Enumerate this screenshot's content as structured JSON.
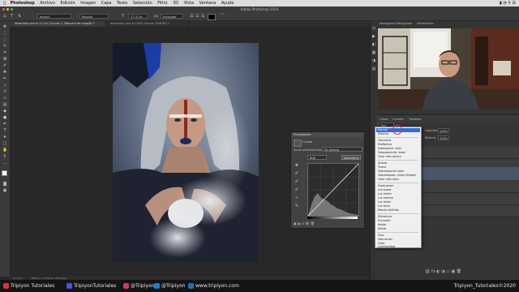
{
  "menu": {
    "app": "Photoshop",
    "items": [
      "Archivo",
      "Edición",
      "Imagen",
      "Capa",
      "Texto",
      "Selección",
      "Filtro",
      "3D",
      "Vista",
      "Ventana",
      "Ayuda"
    ]
  },
  "window": {
    "title": "Adobe Photoshop 2020"
  },
  "options": {
    "font": "Impact",
    "style": "Regular",
    "size": "37.37 pt",
    "aa": "Enfocado"
  },
  "tabs": [
    {
      "label": "desarrollo.psd al 11,1% (Curvas 2, Máscara de capa/8) *"
    },
    {
      "label": "desarrollo_psd al 100% (Fondo, RGB/8*) *"
    }
  ],
  "status": {
    "zoom": "11,11%",
    "info": "3840 px x 5760 px (300 ppp)"
  },
  "panels": {
    "navigator_tabs": [
      "Navegador",
      "Histograma",
      "Información"
    ],
    "layers_tabs": [
      "Capas",
      "Canales",
      "Trazados"
    ],
    "layers_kind": "Tipo",
    "layers_opacity_label": "Opacidad:",
    "layers_opacity_value": "100%",
    "layers_fill_label": "Relleno:",
    "layers_fill_value": "100%"
  },
  "properties": {
    "title": "Propiedades",
    "type": "Curvas",
    "preset_label": "Ajuste preestablecido:",
    "preset_value": "Por defecto",
    "channel": "RGB",
    "auto_button": "Automático"
  },
  "blend_modes": {
    "selected": "Normal",
    "groups": [
      [
        "Normal",
        "Disolver"
      ],
      [
        "Oscurecer",
        "Multiplicar",
        "Subexponer color",
        "Subexposición lineal",
        "Color más oscuro"
      ],
      [
        "Aclarar",
        "Trama",
        "Sobreexponer color",
        "Sobreexposic. lineal (Añadir)",
        "Color más claro"
      ],
      [
        "Superponer",
        "Luz suave",
        "Luz fuerte",
        "Luz intensa",
        "Luz lineal",
        "Luz focal",
        "Mezcla definida"
      ],
      [
        "Diferencia",
        "Exclusión",
        "Restar",
        "Dividir"
      ],
      [
        "Tono",
        "Saturación",
        "Color",
        "Luminosidad"
      ]
    ]
  },
  "footer": [
    {
      "icon": "youtube-icon",
      "text": "Tripiyon Tutoriales",
      "color": "#e03131"
    },
    {
      "icon": "facebook-icon",
      "text": "TripiyonTutoriales",
      "color": "#3b5bdb"
    },
    {
      "icon": "instagram-icon",
      "text": "@Tripiyon",
      "color": "#d6336c"
    },
    {
      "icon": "twitter-icon",
      "text": "@Tripiyon",
      "color": "#1c7ed6"
    },
    {
      "icon": "web-icon",
      "text": "www.tripiyon.com",
      "color": "#1971c2"
    }
  ],
  "footer_right": "Tripiyon_Tutoriales©2020"
}
